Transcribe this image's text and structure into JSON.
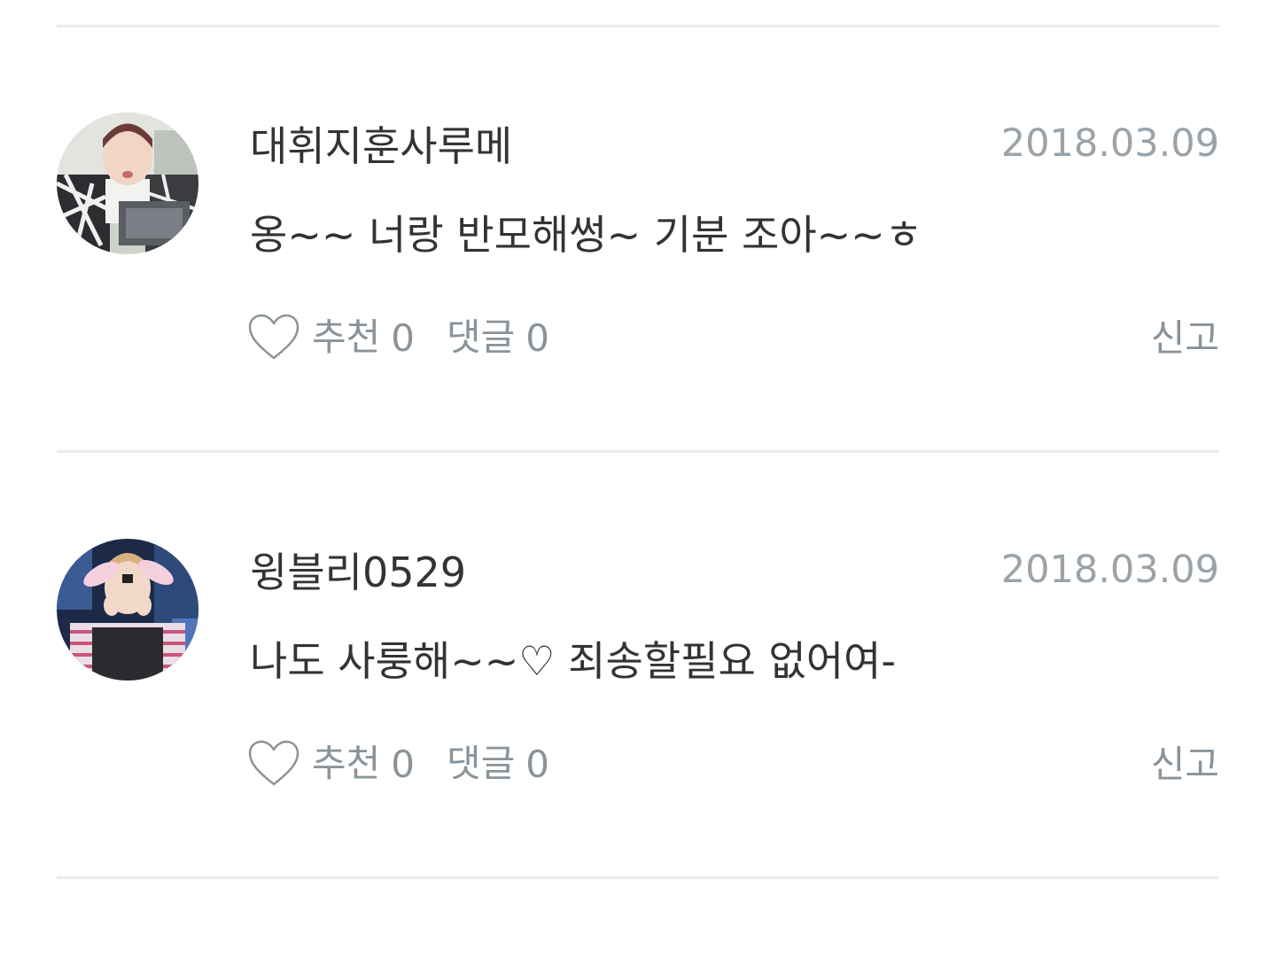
{
  "comments": [
    {
      "username": "대휘지훈사루메",
      "date": "2018.03.09",
      "text": "옹~~ 너랑 반모해썽~ 기분 조아~~ㅎ",
      "like_label": "추천",
      "like_count": "0",
      "reply_label": "댓글",
      "reply_count": "0",
      "report_label": "신고"
    },
    {
      "username": "윙블리0529",
      "date": "2018.03.09",
      "text": "나도 사룽해~~♡ 죄송할필요 없어여-",
      "like_label": "추천",
      "like_count": "0",
      "reply_label": "댓글",
      "reply_count": "0",
      "report_label": "신고"
    }
  ],
  "colors": {
    "divider": "#e9ecec",
    "text_primary": "#333333",
    "text_meta": "#9aa3a9",
    "text_action": "#8a9399"
  },
  "icons": {
    "like": "heart-outline-icon"
  }
}
